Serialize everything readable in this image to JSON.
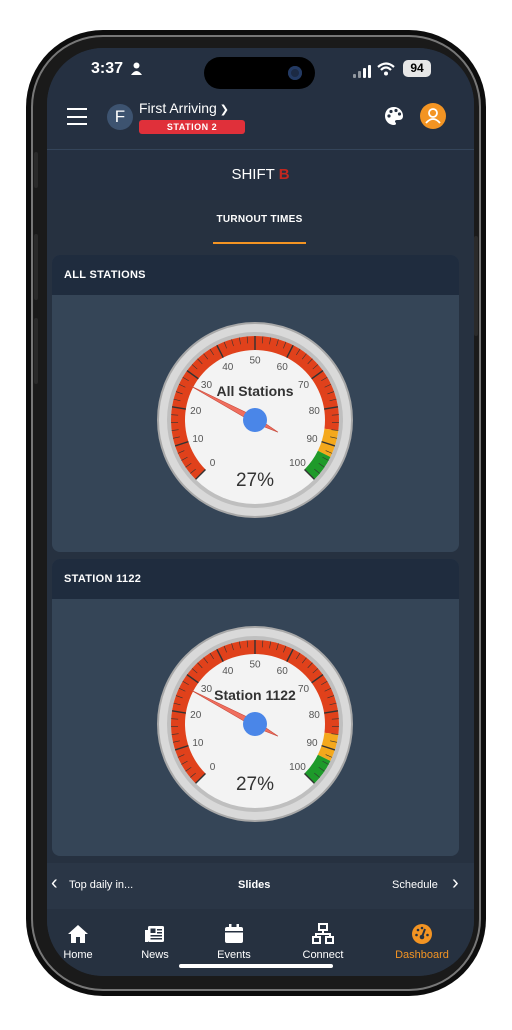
{
  "status": {
    "time": "3:37",
    "battery": "94"
  },
  "header": {
    "org_name": "First Arriving",
    "avatar_letter": "F",
    "station_badge": "STATION 2"
  },
  "shift": {
    "label": "SHIFT",
    "letter": "B"
  },
  "tabs": [
    {
      "label": "TURNOUT TIMES",
      "active": true
    }
  ],
  "cards": [
    {
      "title": "ALL STATIONS",
      "gauge_label": "All Stations",
      "value_text": "27%"
    },
    {
      "title": "STATION 1122",
      "gauge_label": "Station 1122",
      "value_text": "27%"
    }
  ],
  "gauge": {
    "ticks": [
      "0",
      "10",
      "20",
      "30",
      "40",
      "50",
      "60",
      "70",
      "80",
      "90",
      "100"
    ],
    "needle_value": 27,
    "colors": {
      "danger": "#e0411b",
      "warning": "#f4a81c",
      "good": "#1e9a2a",
      "needle": "#f06e5e",
      "hub": "#4a86e8"
    }
  },
  "slides": {
    "prev_label": "Top daily in...",
    "title": "Slides",
    "next_label": "Schedule"
  },
  "nav": [
    {
      "label": "Home",
      "icon": "home-icon"
    },
    {
      "label": "News",
      "icon": "news-icon"
    },
    {
      "label": "Events",
      "icon": "calendar-icon"
    },
    {
      "label": "Connect",
      "icon": "network-icon"
    },
    {
      "label": "Dashboard",
      "icon": "dashboard-icon",
      "active": true
    }
  ]
}
